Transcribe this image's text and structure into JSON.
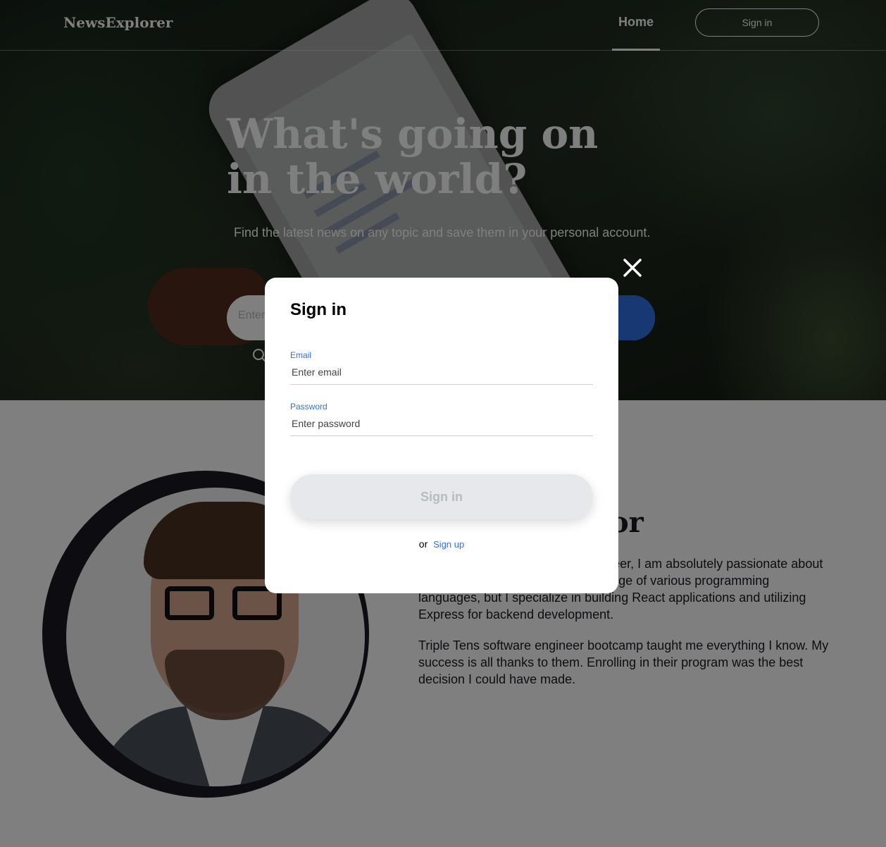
{
  "header": {
    "logo": "NewsExplorer",
    "nav_home": "Home",
    "nav_signin": "Sign in"
  },
  "hero": {
    "title": "What's going on in the world?",
    "subtitle": "Find the latest news on any topic and save them in your personal account.",
    "search_placeholder": "Enter"
  },
  "about": {
    "title_partial": "or",
    "paragraph1": "nic, and I am the creator of this gineer, I am absolutely passionate about what I do. I have extensive knowledge of various programming languages, but I specialize in building React applications and utilizing Express for backend development.",
    "paragraph2": "Triple Tens software engineer bootcamp taught me everything I know. My success is all thanks to them. Enrolling in their program was the best decision I could have made."
  },
  "modal": {
    "title": "Sign in",
    "email_label": "Email",
    "email_placeholder": "Enter email",
    "password_label": "Password",
    "password_placeholder": "Enter password",
    "submit_label": "Sign in",
    "switch_prefix": "or",
    "switch_link": "Sign up"
  },
  "colors": {
    "accent": "#2f71e5",
    "dark": "#1a1b22",
    "disabled_bg": "#e6e8eb",
    "disabled_text": "#b6bcbf"
  },
  "icons": {
    "close": "close-icon",
    "search": "search-icon"
  }
}
